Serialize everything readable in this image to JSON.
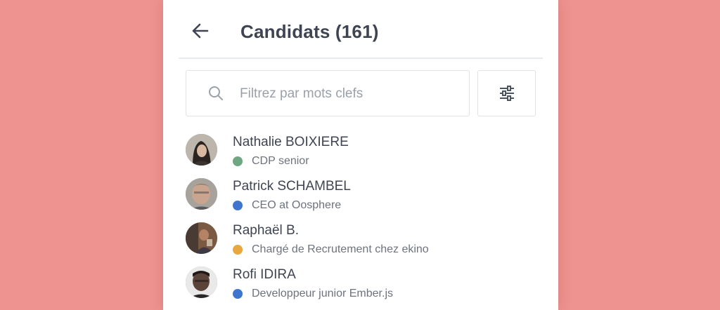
{
  "header": {
    "title": "Candidats (161)",
    "back_icon": "arrow-left-icon"
  },
  "search": {
    "placeholder": "Filtrez par mots clefs",
    "value": "",
    "icon": "search-icon"
  },
  "filter": {
    "icon": "sliders-icon"
  },
  "candidates": [
    {
      "name": "Nathalie BOIXIERE",
      "title": "CDP senior",
      "status_color": "#6fa783"
    },
    {
      "name": "Patrick SCHAMBEL",
      "title": "CEO at Oosphere",
      "status_color": "#3f75cf"
    },
    {
      "name": "Raphaël B.",
      "title": "Chargé de Recrutement chez ekino",
      "status_color": "#e8a73f"
    },
    {
      "name": "Rofi IDIRA",
      "title": "Developpeur junior Ember.js",
      "status_color": "#3f75cf"
    }
  ],
  "colors": {
    "background": "#ee938f",
    "panel": "#ffffff",
    "text": "#3e4452"
  }
}
